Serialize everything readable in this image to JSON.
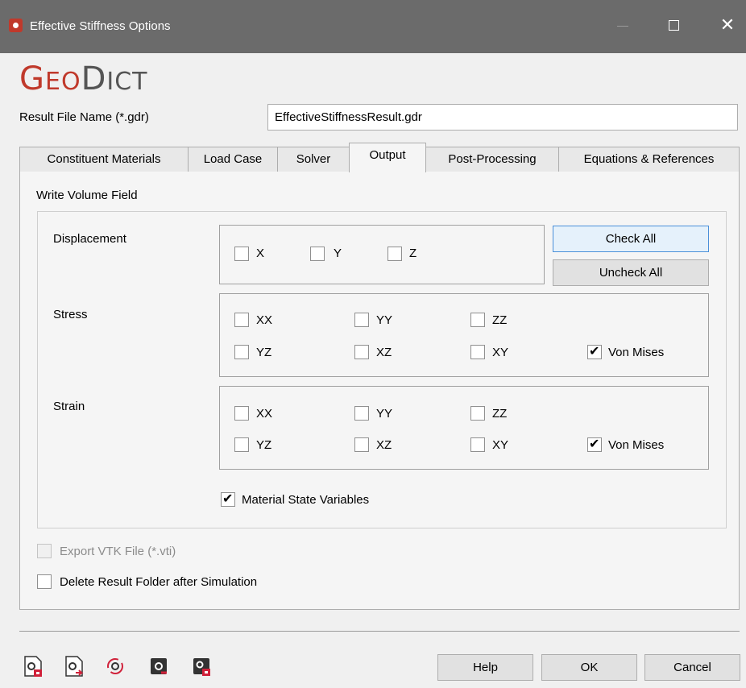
{
  "window": {
    "title": "Effective Stiffness Options"
  },
  "logo": {
    "text_first": "G",
    "text_first_small": "EO",
    "text_second": "D",
    "text_second_small": "ICT"
  },
  "result_file": {
    "label": "Result File Name (*.gdr)",
    "value": "EffectiveStiffnessResult.gdr"
  },
  "tabs": [
    {
      "label": "Constituent Materials",
      "active": false
    },
    {
      "label": "Load Case",
      "active": false
    },
    {
      "label": "Solver",
      "active": false
    },
    {
      "label": "Output",
      "active": true
    },
    {
      "label": "Post-Processing",
      "active": false
    },
    {
      "label": "Equations & References",
      "active": false
    }
  ],
  "output": {
    "section_title": "Write Volume Field",
    "displacement": {
      "label": "Displacement",
      "items": [
        {
          "label": "X",
          "checked": false
        },
        {
          "label": "Y",
          "checked": false
        },
        {
          "label": "Z",
          "checked": false
        }
      ]
    },
    "check_all_label": "Check All",
    "uncheck_all_label": "Uncheck All",
    "stress": {
      "label": "Stress",
      "items": [
        {
          "label": "XX",
          "checked": false
        },
        {
          "label": "YY",
          "checked": false
        },
        {
          "label": "ZZ",
          "checked": false
        },
        {
          "label": "YZ",
          "checked": false
        },
        {
          "label": "XZ",
          "checked": false
        },
        {
          "label": "XY",
          "checked": false
        },
        {
          "label": "Von Mises",
          "checked": true
        }
      ]
    },
    "strain": {
      "label": "Strain",
      "items": [
        {
          "label": "XX",
          "checked": false
        },
        {
          "label": "YY",
          "checked": false
        },
        {
          "label": "ZZ",
          "checked": false
        },
        {
          "label": "YZ",
          "checked": false
        },
        {
          "label": "XZ",
          "checked": false
        },
        {
          "label": "XY",
          "checked": false
        },
        {
          "label": "Von Mises",
          "checked": true
        }
      ]
    },
    "material_state": {
      "label": "Material State Variables",
      "checked": true
    },
    "export_vtk": {
      "label": "Export VTK File (*.vti)",
      "checked": false,
      "enabled": false
    },
    "delete_result": {
      "label": "Delete Result Folder after Simulation",
      "checked": false
    }
  },
  "footer": {
    "icons": [
      "load-settings-icon",
      "save-settings-icon",
      "reset-settings-icon",
      "run-icon",
      "lock-settings-icon"
    ],
    "help_label": "Help",
    "ok_label": "OK",
    "cancel_label": "Cancel"
  },
  "colors": {
    "titlebar": "#6b6b6b",
    "brand_red": "#c0392b",
    "accent_blue": "#4a90d9"
  }
}
